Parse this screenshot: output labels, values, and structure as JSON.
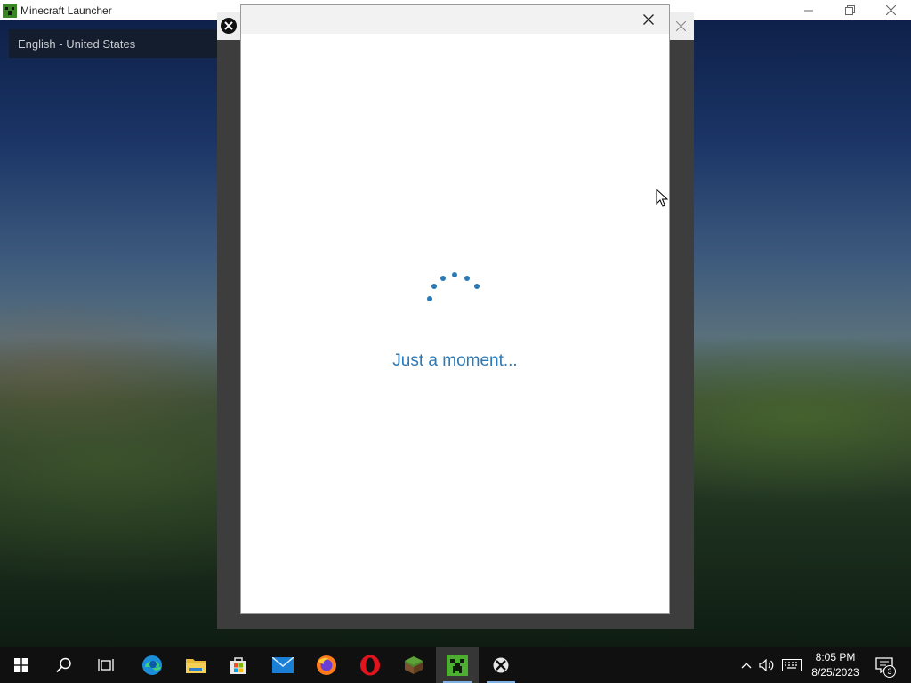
{
  "launcher": {
    "title": "Minecraft Launcher",
    "language_selected": "English - United States"
  },
  "dialog": {
    "loading_text": "Just a moment...",
    "accent_color": "#2a7ab8"
  },
  "taskbar": {
    "items": [
      {
        "name": "start-button",
        "icon": "windows-icon"
      },
      {
        "name": "search-button",
        "icon": "search-icon"
      },
      {
        "name": "task-view-button",
        "icon": "task-view-icon"
      },
      {
        "name": "edge-button",
        "icon": "edge-icon"
      },
      {
        "name": "file-explorer-button",
        "icon": "folder-icon"
      },
      {
        "name": "store-button",
        "icon": "store-icon"
      },
      {
        "name": "mail-button",
        "icon": "mail-icon"
      },
      {
        "name": "firefox-button",
        "icon": "firefox-icon"
      },
      {
        "name": "opera-button",
        "icon": "opera-icon"
      },
      {
        "name": "minecraft-classic-button",
        "icon": "grass-block-icon"
      },
      {
        "name": "minecraft-launcher-button",
        "icon": "creeper-icon"
      },
      {
        "name": "xbox-button",
        "icon": "xbox-icon"
      }
    ],
    "time": "8:05 PM",
    "date": "8/25/2023",
    "notification_count": "3"
  }
}
